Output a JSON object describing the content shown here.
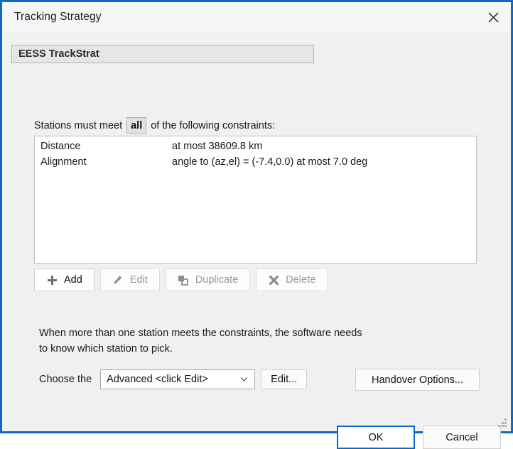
{
  "window": {
    "title": "Tracking Strategy",
    "close_icon": "close-icon",
    "accent_color": "#0b6ac8",
    "background_color": "#f0f0f0"
  },
  "name_field": {
    "value": "EESS TrackStrat"
  },
  "constraints_section": {
    "lead_text": "Stations must meet",
    "quantifier": "all",
    "trail_text": "of the following constraints:",
    "rows": [
      {
        "name": "Distance",
        "description": "at most 38609.8 km"
      },
      {
        "name": "Alignment",
        "description": "angle to (az,el) = (-7.4,0.0) at most 7.0 deg"
      }
    ]
  },
  "action_buttons": [
    {
      "label": "Add",
      "icon": "plus-icon",
      "enabled": true
    },
    {
      "label": "Edit",
      "icon": "pencil-icon",
      "enabled": false
    },
    {
      "label": "Duplicate",
      "icon": "copy-icon",
      "enabled": false
    },
    {
      "label": "Delete",
      "icon": "x-mark-icon",
      "enabled": false
    }
  ],
  "explanation": {
    "line1": "When more than one station meets the constraints, the software needs",
    "line2": "to know which station to pick."
  },
  "choose_row": {
    "label": "Choose the",
    "selected_option": "Advanced <click Edit>",
    "chevron_icon": "chevron-down-icon",
    "edit_label": "Edit...",
    "handover_label": "Handover Options..."
  },
  "footer": {
    "ok_label": "OK",
    "cancel_label": "Cancel"
  }
}
